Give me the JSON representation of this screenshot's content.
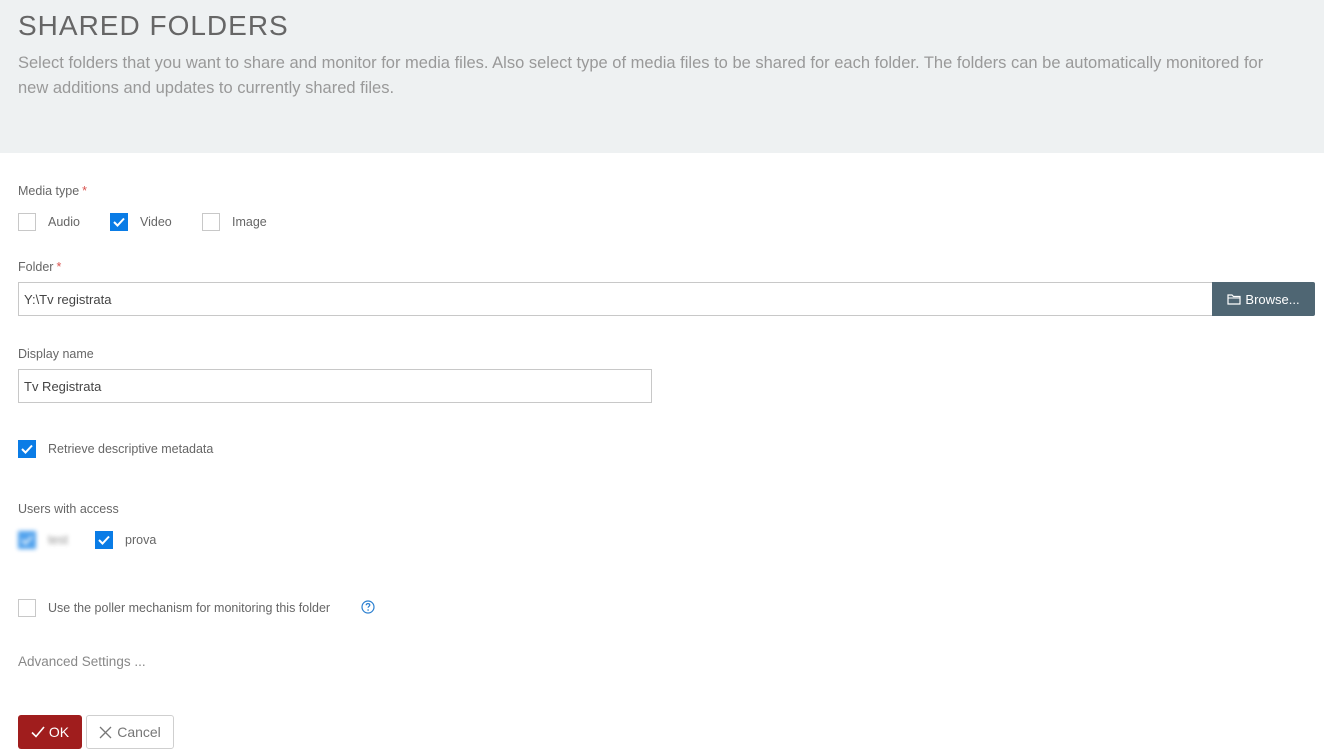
{
  "header": {
    "title": "SHARED FOLDERS",
    "description": "Select folders that you want to share and monitor for media files. Also select type of media files to be shared for each folder. The folders can be automatically monitored for new additions and updates to currently shared files."
  },
  "media_type": {
    "label": "Media type",
    "required_mark": "*",
    "options": [
      {
        "label": "Audio",
        "checked": false
      },
      {
        "label": "Video",
        "checked": true
      },
      {
        "label": "Image",
        "checked": false
      }
    ]
  },
  "folder": {
    "label": "Folder",
    "required_mark": "*",
    "value": "Y:\\Tv registrata",
    "browse_label": "Browse..."
  },
  "display_name": {
    "label": "Display name",
    "value": "Tv Registrata"
  },
  "metadata": {
    "label": "Retrieve descriptive metadata",
    "checked": true
  },
  "users": {
    "label": "Users with access",
    "items": [
      {
        "label": "test",
        "checked": true
      },
      {
        "label": "prova",
        "checked": true
      }
    ]
  },
  "poller": {
    "label": "Use the poller mechanism for monitoring this folder",
    "checked": false
  },
  "advanced_label": "Advanced Settings ...",
  "buttons": {
    "ok_label": "OK",
    "cancel_label": "Cancel"
  },
  "colors": {
    "accent": "#0a7ce6",
    "ok": "#a01d1d",
    "browse": "#4f6673",
    "header_bg": "#eef1f2"
  }
}
